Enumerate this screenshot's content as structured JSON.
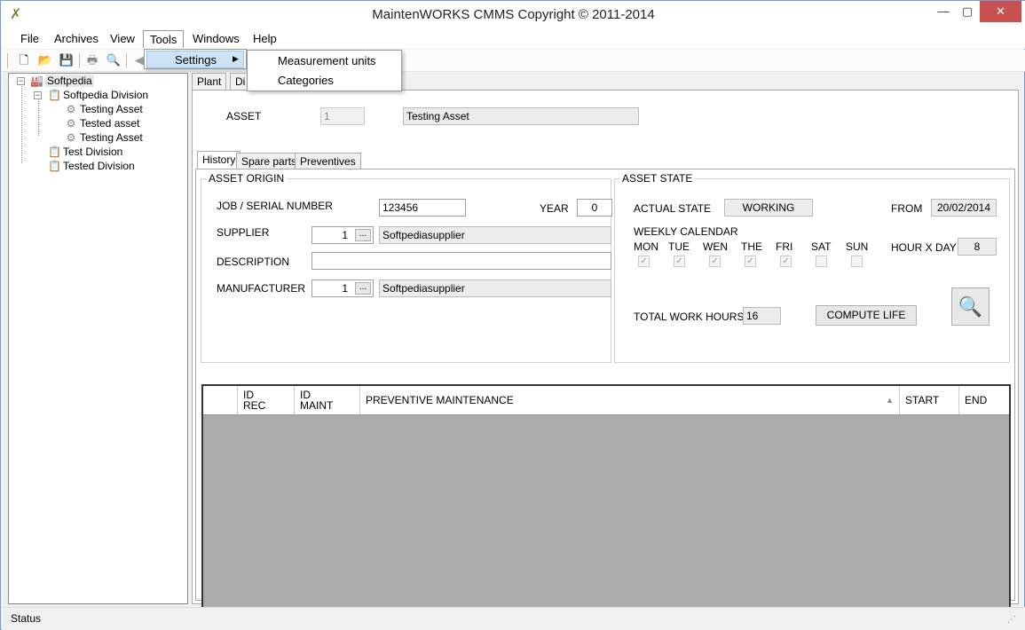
{
  "window": {
    "title": "MaintenWORKS CMMS Copyright © 2011-2014",
    "controls": {
      "minimize": "—",
      "maximize": "▢",
      "close": "✕"
    }
  },
  "menubar": {
    "items": [
      "File",
      "Archives",
      "View",
      "Tools",
      "Windows",
      "Help"
    ]
  },
  "tools_menu": {
    "settings_label": "Settings",
    "submenu": [
      "Measurement units",
      "Categories"
    ]
  },
  "tree": {
    "root": "Softpedia",
    "division1": "Softpedia Division",
    "assets": [
      "Testing Asset",
      "Tested asset",
      "Testing Asset"
    ],
    "division2": "Test Division",
    "division3": "Tested Division"
  },
  "top_tabs": [
    "Plant",
    "Di"
  ],
  "asset": {
    "label": "ASSET",
    "id": "1",
    "name": "Testing Asset"
  },
  "sub_tabs": [
    "History",
    "Spare parts",
    "Preventives"
  ],
  "asset_origin": {
    "title": "ASSET ORIGIN",
    "serial_label": "JOB / SERIAL NUMBER",
    "serial_value": "123456",
    "year_label": "YEAR",
    "year_value": "0",
    "supplier_label": "SUPPLIER",
    "supplier_id": "1",
    "supplier_name": "Softpediasupplier",
    "description_label": "DESCRIPTION",
    "description_value": "",
    "manufacturer_label": "MANUFACTURER",
    "manufacturer_id": "1",
    "manufacturer_name": "Softpediasupplier",
    "browse": "..."
  },
  "asset_state": {
    "title": "ASSET STATE",
    "actual_label": "ACTUAL STATE",
    "actual_value": "WORKING",
    "from_label": "FROM",
    "from_value": "20/02/2014",
    "weekly_label": "WEEKLY CALENDAR",
    "days": [
      "MON",
      "TUE",
      "WEN",
      "THE",
      "FRI",
      "SAT",
      "SUN"
    ],
    "days_checked": [
      true,
      true,
      true,
      true,
      true,
      false,
      false
    ],
    "hour_label": "HOUR X DAY",
    "hour_value": "8",
    "total_label": "TOTAL WORK HOURS",
    "total_value": "16",
    "compute_label": "COMPUTE LIFE"
  },
  "grid": {
    "columns": [
      "ID\nREC",
      "ID\nMAINT",
      "PREVENTIVE MAINTENANCE",
      "START",
      "END"
    ],
    "col_idrec_1": "ID",
    "col_idrec_2": "REC",
    "col_idmaint_1": "ID",
    "col_idmaint_2": "MAINT",
    "col_preventive": "PREVENTIVE MAINTENANCE",
    "col_start": "START",
    "col_end": "END"
  },
  "status": {
    "text": "Status"
  },
  "colors": {
    "close_button": "#c75050",
    "menu_highlight": "#cde4f7",
    "grid_background": "#ababab"
  }
}
